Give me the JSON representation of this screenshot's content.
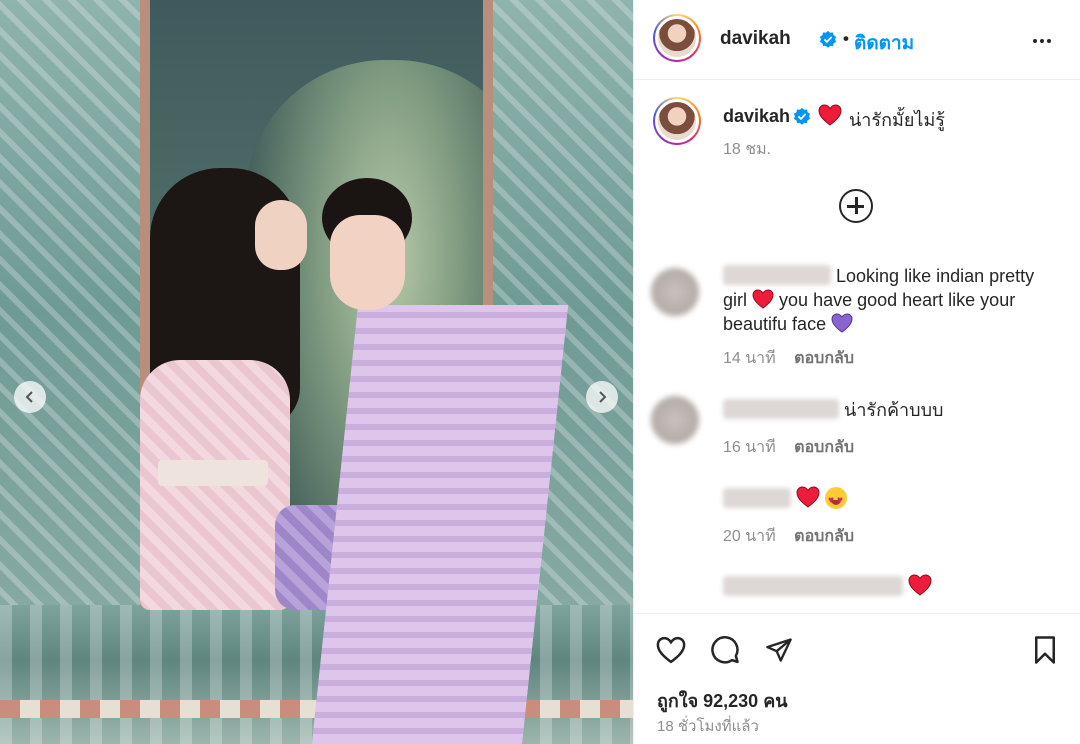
{
  "post": {
    "username": "davikah",
    "verified": true,
    "follow_label": "ติดตาม",
    "dot": "•"
  },
  "caption": {
    "username": "davikah",
    "text": "น่ารักมั้ยไม่รู้",
    "time": "18 ชม."
  },
  "comments": [
    {
      "username_visible": "Looking like indian pretty girl",
      "text_after_heart": "you have good heart like your beautifu face",
      "time": "14 นาที",
      "reply_label": "ตอบกลับ"
    },
    {
      "text": "น่ารักค้าบบบ",
      "time": "16 นาที",
      "reply_label": "ตอบกลับ"
    },
    {
      "time": "20 นาที",
      "reply_label": "ตอบกลับ"
    }
  ],
  "likes_label": "ถูกใจ 92,230 คน",
  "posted_ago": "18 ชั่วโมงที่แล้ว",
  "colors": {
    "follow_blue": "#0095f6",
    "heart_red": "#ed1c3a",
    "purple_heart": "#8a63d2"
  }
}
